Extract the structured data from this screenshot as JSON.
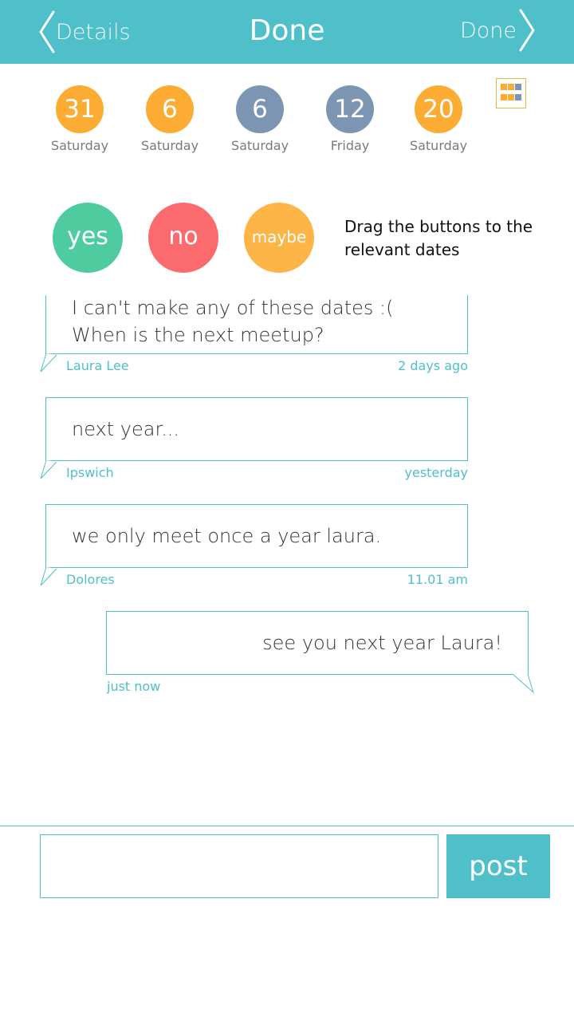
{
  "header": {
    "back_label": "Details",
    "title": "Done",
    "forward_label": "Done",
    "color": "#4fbfc9"
  },
  "dates": [
    {
      "number": "31",
      "day": "Saturday",
      "color": "#fdac33"
    },
    {
      "number": "6",
      "day": "Saturday",
      "color": "#fdac33"
    },
    {
      "number": "6",
      "day": "Saturday",
      "color": "#7b95b3"
    },
    {
      "number": "12",
      "day": "Friday",
      "color": "#7b95b3"
    },
    {
      "number": "20",
      "day": "Saturday",
      "color": "#fdac33"
    }
  ],
  "view_toggle": {
    "icon": "grid-icon"
  },
  "votes": {
    "yes_label": "yes",
    "no_label": "no",
    "maybe_label": "maybe",
    "hint": "Drag the buttons to the relevant dates"
  },
  "messages": [
    {
      "text": "I can't make any of these dates :( When is the next meetup?",
      "author": "Laura Lee",
      "time": "2 days ago",
      "side": "left"
    },
    {
      "text": "next year...",
      "author": "Ipswich",
      "time": "yesterday",
      "side": "left"
    },
    {
      "text": "we only meet once a year laura.",
      "author": "Dolores",
      "time": "11.01 am",
      "side": "left"
    },
    {
      "text": "see you next year Laura!",
      "author": "",
      "time": "just now",
      "side": "right"
    }
  ],
  "composer": {
    "placeholder": "",
    "post_label": "post"
  }
}
